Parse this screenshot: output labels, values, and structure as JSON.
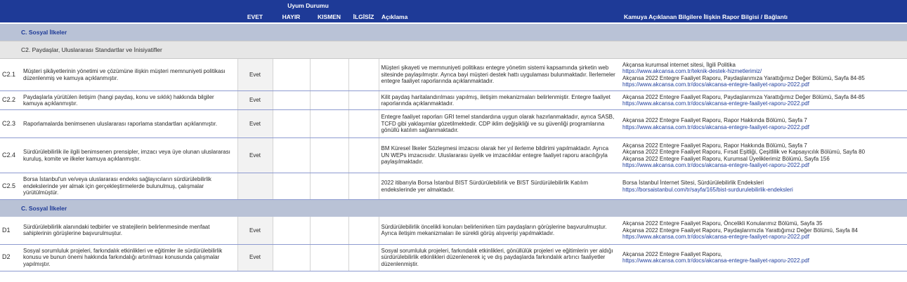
{
  "header": {
    "uyum_durumu": "Uyum Durumu",
    "evet": "EVET",
    "hayir": "HAYIR",
    "kismen": "KISMEN",
    "ilgisiz": "İLGİSİZ",
    "aciklama": "Açıklama",
    "rapor_bilgisi": "Kamuya Açıklanan Bilgilere İlişkin Rapor Bilgisi / Bağlantı"
  },
  "sections": [
    {
      "label": "C. Sosyal İlkeler"
    },
    {
      "label": "C. Sosyal İlkeler"
    }
  ],
  "subsection": {
    "label": "C2. Paydaşlar, Uluslararası Standartlar ve İnisiyatifler"
  },
  "rows": [
    {
      "code": "C2.1",
      "description": "Müşteri şikâyetlerinin yönetimi ve çözümüne ilişkin müşteri memnuniyeti politikası düzenlenmiş ve kamuya açıklanmıştır.",
      "status": "Evet",
      "explanation": "Müşteri şikayeti ve memnuniyeti politikası entegre yönetim sistemi kapsamında şirketin web sitesinde paylaşılmıştır. Ayrıca bayi müşteri destek hattı uygulaması bulunmaktadır. İlerlemeler entegre faaliyet raporlarında açıklanmaktadır.",
      "refs": [
        {
          "text": "Akçansa kurumsal internet sitesi, İlgili Politika",
          "link": false
        },
        {
          "text": "https://www.akcansa.com.tr/teknik-destek-hizmetlerimiz/",
          "link": true
        },
        {
          "text": "Akçansa 2022 Entegre Faaliyet Raporu, Paydaşlarımıza Yarattığımız Değer Bölümü, Sayfa 84-85",
          "link": false
        },
        {
          "text": "https://www.akcansa.com.tr/docs/akcansa-entegre-faaliyet-raporu-2022.pdf",
          "link": true
        }
      ]
    },
    {
      "code": "C2.2",
      "description": "Paydaşlarla yürütülen iletişim (hangi paydaş, konu ve sıklık) hakkında bilgiler kamuya açıklanmıştır.",
      "status": "Evet",
      "explanation": "Kilit paydaş haritalandırılması yapılmış, iletişim mekanizmaları belirlenmiştir. Entegre faaliyet raporlarında açıklanmaktadır.",
      "refs": [
        {
          "text": "Akçansa 2022 Entegre Faaliyet Raporu, Paydaşlarımıza Yarattığımız Değer Bölümü, Sayfa 84-85",
          "link": false
        },
        {
          "text": "https://www.akcansa.com.tr/docs/akcansa-entegre-faaliyet-raporu-2022.pdf",
          "link": true
        }
      ]
    },
    {
      "code": "C2.3",
      "description": "Raporlamalarda benimsenen uluslararası raporlama standartları açıklanmıştır.",
      "status": "Evet",
      "explanation": "Entegre faaliyet raporları GRI temel standardına uygun olarak hazırlanmaktadır, ayrıca SASB, TCFD gibi yaklaşımlar gözetilmektedir. CDP iklim değişikliği ve su güvenliği programlarına gönüllü katılım sağlanmaktadır.",
      "refs": [
        {
          "text": "Akçansa 2022 Entegre Faaliyet Raporu, Rapor Hakkında Bölümü, Sayfa 7",
          "link": false
        },
        {
          "text": "https://www.akcansa.com.tr/docs/akcansa-entegre-faaliyet-raporu-2022.pdf",
          "link": true
        }
      ]
    },
    {
      "code": "C2.4",
      "description": "Sürdürülebilirlik ile ilgili benimsenen prensipler, imzacı veya üye olunan uluslararası kuruluş, komite ve ilkeler kamuya açıklanmıştır.",
      "status": "Evet",
      "explanation": "BM Küresel İlkeler Sözleşmesi imzacısı olarak her yıl ilerleme bildirimi yapılmaktadır. Ayrıca UN WEPs imzacısıdır. Uluslararası üyelik ve imzacılıklar entegre faaliyet raporu aracılığıyla paylaşılmaktadır.",
      "refs": [
        {
          "text": "Akçansa 2022 Entegre Faaliyet Raporu, Rapor Hakkında Bölümü, Sayfa 7",
          "link": false
        },
        {
          "text": "Akçansa 2022 Entegre Faaliyet Raporu, Fırsat Eşitliği, Çeşitlilik ve Kapsayıcılık Bölümü, Sayfa 80",
          "link": false
        },
        {
          "text": "Akçansa 2022 Entegre Faaliyet Raporu, Kurumsal Üyeliklerimiz Bölümü, Sayfa 156",
          "link": false
        },
        {
          "text": "https://www.akcansa.com.tr/docs/akcansa-entegre-faaliyet-raporu-2022.pdf",
          "link": true
        }
      ]
    },
    {
      "code": "C2.5",
      "description": "Borsa İstanbul'un ve/veya uluslararası endeks sağlayıcıların sürdürülebilirlik endekslerinde yer almak için gerçekleştirmelerde bulunulmuş, çalışmalar yürütülmüştür.",
      "status": "",
      "explanation": "2022 itibarıyla Borsa İstanbul BIST Sürdürülebilirlik ve BIST Sürdürülebilirlik Katılım endekslerinde yer almaktadır.",
      "refs": [
        {
          "text": "Borsa İstanbul İnternet Sitesi, Sürdürülebilirlik Endeksleri",
          "link": false
        },
        {
          "text": "https://borsaistanbul.com/tr/sayfa/165/bist-surdurulebilirlik-endeksleri",
          "link": true
        }
      ]
    },
    {
      "code": "D1",
      "description": "Sürdürülebilirlik alanındaki tedbirler ve stratejilerin belirlenmesinde menfaat sahiplerinin görüşlerine başvurulmuştur.",
      "status": "Evet",
      "explanation": "Sürdürülebilirlik öncelikli konuları belirlenirken tüm paydaşların görüşlerine başvurulmuştur. Ayrıca iletişim mekanizmaları ile sürekli görüş alışverişi yapılmaktadır.",
      "refs": [
        {
          "text": "Akçansa 2022 Entegre Faaliyet Raporu, Öncelikli Konularımız Bölümü, Sayfa 35",
          "link": false
        },
        {
          "text": "Akçansa 2022 Entegre Faaliyet Raporu, Paydaşlarımızla Yarattığımız Değer Bölümü, Sayfa 84",
          "link": false
        },
        {
          "text": "https://www.akcansa.com.tr/docs/akcansa-entegre-faaliyet-raporu-2022.pdf",
          "link": true
        }
      ]
    },
    {
      "code": "D2",
      "description": "Sosyal sorumluluk projeleri, farkındalık etkinlikleri ve eğitimler ile sürdürülebilirlik konusu ve bunun önemi hakkında farkındalığı artırılması konusunda çalışmalar yapılmıştır.",
      "status": "Evet",
      "explanation": "Sosyal sorumluluk projeleri, farkındalık etkinlikleri, gönüllülük projeleri ve eğitimlerin yer aldığı sürdürülebilirlik etkinlikleri düzenlenerek iç ve dış paydaşlarda farkındalık artırıcı faaliyetler düzenlenmiştir.",
      "refs": [
        {
          "text": "Akçansa 2022 Entegre Faaliyet Raporu,",
          "link": false
        },
        {
          "text": "https://www.akcansa.com.tr/docs/akcansa-entegre-faaliyet-raporu-2022.pdf",
          "link": true
        }
      ]
    }
  ]
}
